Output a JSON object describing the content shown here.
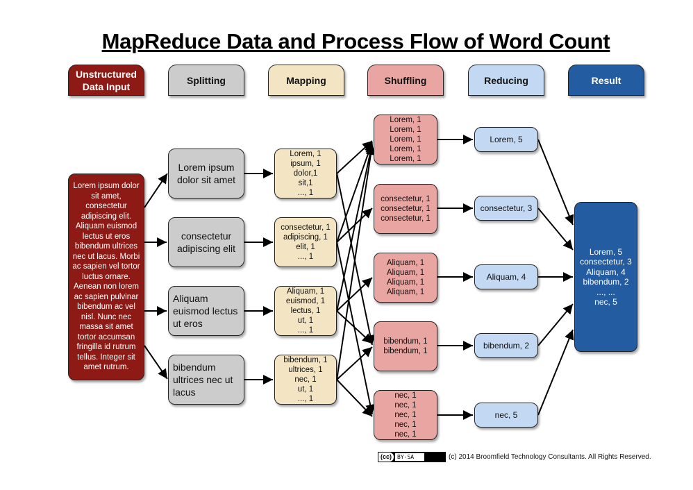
{
  "title": "MapReduce Data and Process Flow of Word Count",
  "headers": [
    {
      "label": "Unstructured Data Input",
      "color": "#8e1a15"
    },
    {
      "label": "Splitting",
      "color": "#cccccc"
    },
    {
      "label": "Mapping",
      "color": "#f3e4c4"
    },
    {
      "label": "Shuffling",
      "color": "#e8a5a2"
    },
    {
      "label": "Reducing",
      "color": "#c3d8f2"
    },
    {
      "label": "Result",
      "color": "#245ca1"
    }
  ],
  "input": {
    "text": "Lorem ipsum dolor sit amet, consectetur adipiscing elit. Aliquam euismod lectus ut eros bibendum ultrices nec ut lacus. Morbi ac sapien vel tortor luctus ornare. Aenean non lorem ac sapien pulvinar bibendum ac vel nisl. Nunc nec massa sit amet tortor accumsan fringilla id rutrum tellus. Integer sit amet rutrum."
  },
  "splits": [
    "Lorem ipsum dolor sit amet",
    "consectetur adipiscing elit",
    "Aliquam euismod lectus ut eros",
    "bibendum ultrices nec ut lacus"
  ],
  "maps": [
    "Lorem, 1\nipsum, 1\ndolor,1\nsit,1\n..., 1",
    "consectetur, 1\nadipiscing, 1\nelit, 1\n..., 1",
    "Aliquam, 1\neuismod, 1\nlectus, 1\nut, 1\n..., 1",
    "bibendum, 1\nultrices, 1\nnec, 1\nut, 1\n..., 1"
  ],
  "shuffles": [
    "Lorem, 1\nLorem, 1\nLorem, 1\nLorem, 1\nLorem, 1",
    "consectetur, 1\nconsectetur, 1\nconsectetur, 1",
    "Aliquam, 1\nAliquam, 1\nAliquam, 1\nAliquam, 1",
    "bibendum, 1\nbibendum, 1",
    "nec, 1\nnec, 1\nnec, 1\nnec, 1\nnec, 1"
  ],
  "reduces": [
    "Lorem, 5",
    "consectetur, 3",
    "Aliquam, 4",
    "bibendum, 2",
    "nec, 5"
  ],
  "result": "Lorem, 5\nconsectetur, 3\nAliquam, 4\nbibendum, 2\n..., ...\nnec, 5",
  "footer": {
    "license_logo": "(cc)",
    "license_label": "BY-SA",
    "copyright": "(c) 2014 Broomfield Technology Consultants. All Rights Reserved."
  }
}
